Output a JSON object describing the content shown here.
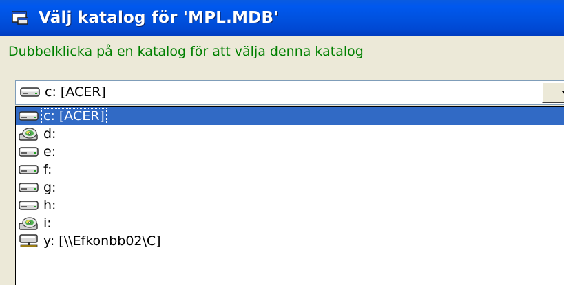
{
  "window": {
    "title": "Välj katalog för 'MPL.MDB'",
    "title_icon": "dialog-app-icon",
    "title_bar_color": "#0054E3"
  },
  "instruction": "Dubbelklicka på en katalog för att välja denna katalog",
  "drive_combo": {
    "selected_label": "c: [ACER]",
    "selected_icon": "hard-drive-icon",
    "dropdown_icon": "dropdown-arrow-icon"
  },
  "drive_list": {
    "selection_color": "#316AC5",
    "items": [
      {
        "label": "c: [ACER]",
        "icon": "hard-drive-icon",
        "selected": true
      },
      {
        "label": "d:",
        "icon": "cd-drive-icon",
        "selected": false
      },
      {
        "label": "e:",
        "icon": "hard-drive-icon",
        "selected": false
      },
      {
        "label": "f:",
        "icon": "hard-drive-icon",
        "selected": false
      },
      {
        "label": "g:",
        "icon": "hard-drive-icon",
        "selected": false
      },
      {
        "label": "h:",
        "icon": "hard-drive-icon",
        "selected": false
      },
      {
        "label": "i:",
        "icon": "cd-drive-icon",
        "selected": false
      },
      {
        "label": "y: [\\\\Efkonbb02\\C]",
        "icon": "network-drive-icon",
        "selected": false
      }
    ]
  }
}
